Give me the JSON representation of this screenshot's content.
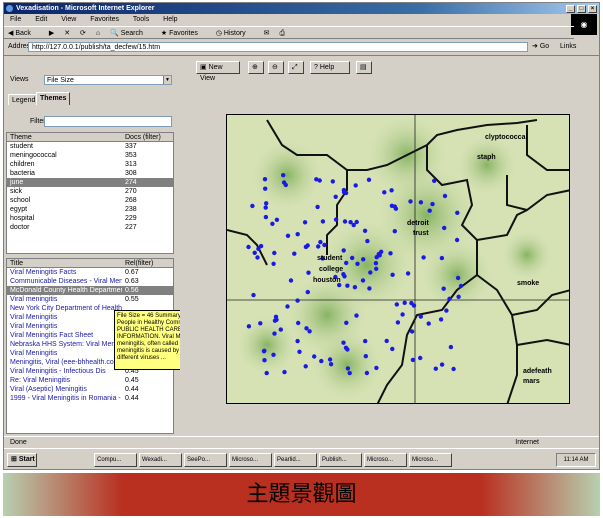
{
  "window": {
    "title": "Vexadisation - Microsoft Internet Explorer"
  },
  "menu": [
    "File",
    "Edit",
    "View",
    "Favorites",
    "Tools",
    "Help"
  ],
  "toolbar": {
    "back": "Back",
    "search": "Search",
    "favorites": "Favorites",
    "history": "History"
  },
  "address": {
    "label": "Address",
    "url": "http://127.0.0.1/publish/ta_decfew/15.htm",
    "go": "Go",
    "links": "Links"
  },
  "left": {
    "views_label": "Views",
    "views_value": "File Size",
    "tabs": [
      "Legend",
      "Themes"
    ],
    "filter_label": "Filter:",
    "themes_headers": [
      "Theme",
      "Docs (filter)"
    ],
    "themes": [
      {
        "name": "student",
        "count": "337"
      },
      {
        "name": "meningococcal",
        "count": "353"
      },
      {
        "name": "children",
        "count": "313"
      },
      {
        "name": "bacteria",
        "count": "308"
      },
      {
        "name": "june",
        "count": "274"
      },
      {
        "name": "sick",
        "count": "270"
      },
      {
        "name": "school",
        "count": "268"
      },
      {
        "name": "egypt",
        "count": "238"
      },
      {
        "name": "hospital",
        "count": "229"
      },
      {
        "name": "doctor",
        "count": "227"
      }
    ],
    "docs_headers": [
      "Title",
      "Rel(filter)"
    ],
    "docs": [
      {
        "title": "Viral Meningitis Facts",
        "rel": "0.67"
      },
      {
        "title": "Communicable Diseases - Viral Meningitis",
        "rel": "0.63"
      },
      {
        "title": "McDonald County Health Department Fa",
        "rel": "0.56"
      },
      {
        "title": "Viral meningitis",
        "rel": "0.55"
      },
      {
        "title": "New York City Department of Health",
        "rel": ""
      },
      {
        "title": "Viral Meningitis",
        "rel": ""
      },
      {
        "title": "Viral Meningitis",
        "rel": ""
      },
      {
        "title": "Viral Meningitis Fact Sheet",
        "rel": ""
      },
      {
        "title": "Nebraska HHS System: Viral Meningitis",
        "rel": ""
      },
      {
        "title": "Viral Meningitis",
        "rel": "0.46"
      },
      {
        "title": "Meningitis, Viral (eee-bhhealth.com",
        "rel": "0.45"
      },
      {
        "title": "Viral Meningitis - Infectious Dis",
        "rel": "0.45"
      },
      {
        "title": "Re: Viral Meningitis",
        "rel": "0.45"
      },
      {
        "title": "Viral (Aseptic) Meningitis",
        "rel": "0.44"
      },
      {
        "title": "1999 - Viral Meningitis in Romania - Sudor",
        "rel": "0.44"
      }
    ],
    "tooltip": "File Size = 46\nSummary = Healthy People in Healthy Communities. PUBLIC HEALTH CARE INFORMATION. Viral Meningitis. Viral meningitis, often called aseptic meningitis is caused by one of many different viruses ..."
  },
  "viewer": {
    "buttons": [
      "New View",
      "Help"
    ]
  },
  "map": {
    "labels": [
      "clyptococcal",
      "staph",
      "detroit",
      "trust",
      "student",
      "college",
      "houston",
      "smoke",
      "adefeath",
      "mars"
    ],
    "dot_color": "#1a1ae6",
    "background": "#c8d8a8",
    "border_color": "#111111"
  },
  "status": {
    "left": "Done",
    "zone": "Internet"
  },
  "taskbar": {
    "start": "Start",
    "tasks": [
      "Compu...",
      "Wexadi...",
      "SeePo...",
      "Microso...",
      "Pearlid...",
      "Publish...",
      "Microso...",
      "Microso..."
    ],
    "clock": "11:14 AM"
  },
  "caption": "主題景觀圖"
}
